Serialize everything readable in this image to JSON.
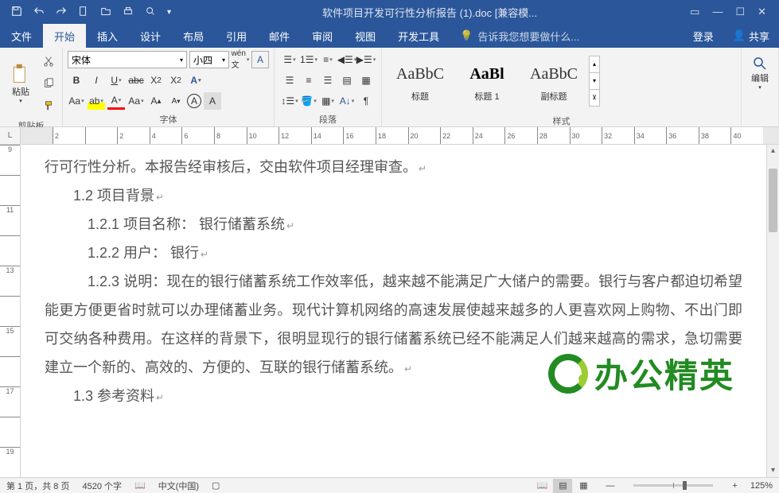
{
  "titlebar": {
    "title": "软件项目开发可行性分析报告 (1).doc [兼容模...",
    "qat": [
      "save",
      "undo",
      "redo",
      "new",
      "open",
      "quickprint",
      "printpreview"
    ]
  },
  "tabs": {
    "file": "文件",
    "items": [
      "开始",
      "插入",
      "设计",
      "布局",
      "引用",
      "邮件",
      "审阅",
      "视图",
      "开发工具"
    ],
    "active_index": 0,
    "tell_me": "告诉我您想要做什么...",
    "login": "登录",
    "share": "共享"
  },
  "ribbon": {
    "clipboard": {
      "paste": "粘贴",
      "label": "剪贴板"
    },
    "font": {
      "font_name": "宋体",
      "font_size": "小四",
      "label": "字体"
    },
    "paragraph": {
      "label": "段落"
    },
    "styles": {
      "label": "样式",
      "items": [
        {
          "preview": "AaBbC",
          "name": "标题",
          "bold": false
        },
        {
          "preview": "AaBl",
          "name": "标题 1",
          "bold": true
        },
        {
          "preview": "AaBbC",
          "name": "副标题",
          "bold": false
        }
      ]
    },
    "edit": {
      "label": "编辑"
    }
  },
  "ruler_h": [
    "2",
    "",
    "2",
    "4",
    "6",
    "8",
    "10",
    "12",
    "14",
    "16",
    "18",
    "20",
    "22",
    "24",
    "26",
    "28",
    "30",
    "32",
    "34",
    "36",
    "38",
    "40"
  ],
  "ruler_v": [
    "9",
    "",
    "11",
    "",
    "13",
    "",
    "15",
    "",
    "17",
    "",
    "19"
  ],
  "document": {
    "line1": "行可行性分析。本报告经审核后，交由软件项目经理审查。",
    "h2_1": "1.2 项目背景",
    "h3_1": "1.2.1 项目名称： 银行储蓄系统",
    "h3_2": "1.2.2 用户： 银行",
    "body": "1.2.3 说明：现在的银行储蓄系统工作效率低，越来越不能满足广大储户的需要。银行与客户都迫切希望能更方便更省时就可以办理储蓄业务。现代计算机网络的高速发展使越来越多的人更喜欢网上购物、不出门即可交纳各种费用。在这样的背景下，很明显现行的银行储蓄系统已经不能满足人们越来越高的需求，急切需要建立一个新的、高效的、方便的、互联的银行储蓄系统。",
    "h2_2": "1.3 参考资料"
  },
  "watermark": "办公精英",
  "statusbar": {
    "page": "第 1 页，共 8 页",
    "words": "4520 个字",
    "lang": "中文(中国)",
    "zoom": "125%"
  }
}
